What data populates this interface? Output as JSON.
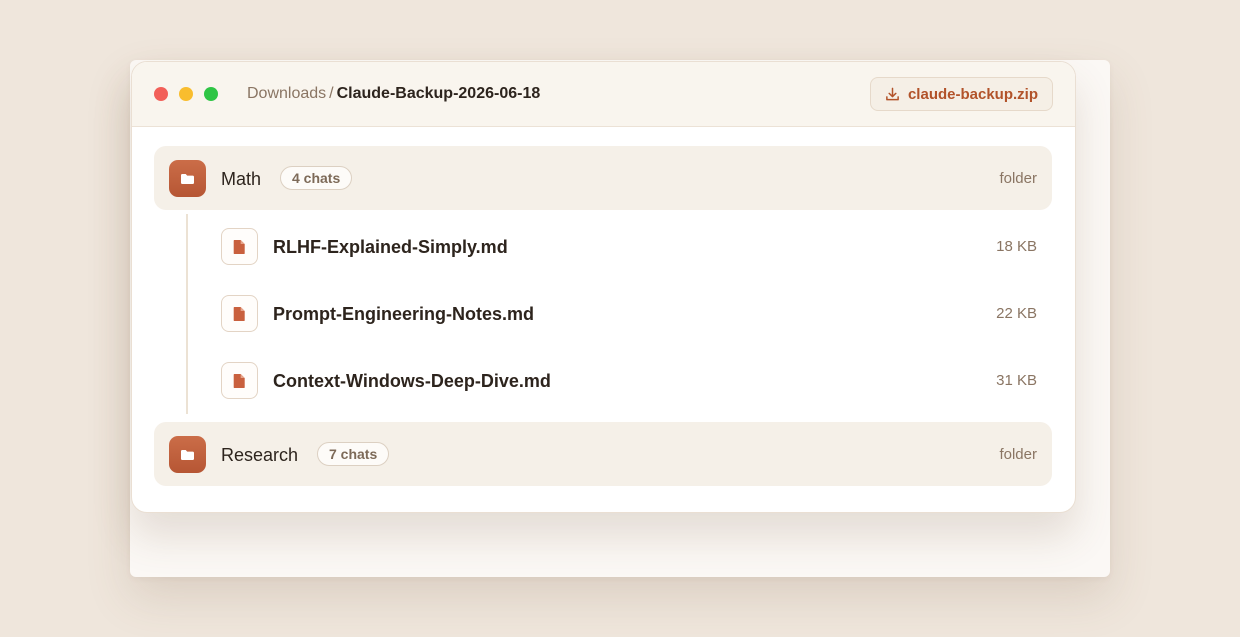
{
  "window": {
    "breadcrumb": {
      "root": "Downloads",
      "separator": "/",
      "current": "Claude-Backup-2026-06-18"
    },
    "download_button": {
      "label": "claude-backup.zip",
      "icon": "download-icon"
    }
  },
  "folders": [
    {
      "name": "Math",
      "badge": "4 chats",
      "type": "folder",
      "icon": "folder-icon",
      "expanded": true,
      "files": [
        {
          "name": "RLHF-Explained-Simply.md",
          "size": "18 KB",
          "icon": "file-icon"
        },
        {
          "name": "Prompt-Engineering-Notes.md",
          "size": "22 KB",
          "icon": "file-icon"
        },
        {
          "name": "Context-Windows-Deep-Dive.md",
          "size": "31 KB",
          "icon": "file-icon"
        }
      ]
    },
    {
      "name": "Research",
      "badge": "7 chats",
      "type": "folder",
      "icon": "folder-icon",
      "expanded": false,
      "files": []
    }
  ],
  "colors": {
    "accent": "#b2532a",
    "folder_icon": "#c1603d",
    "traffic_red": "#f25f58",
    "traffic_yellow": "#f9bd2e",
    "traffic_green": "#2fc545"
  }
}
